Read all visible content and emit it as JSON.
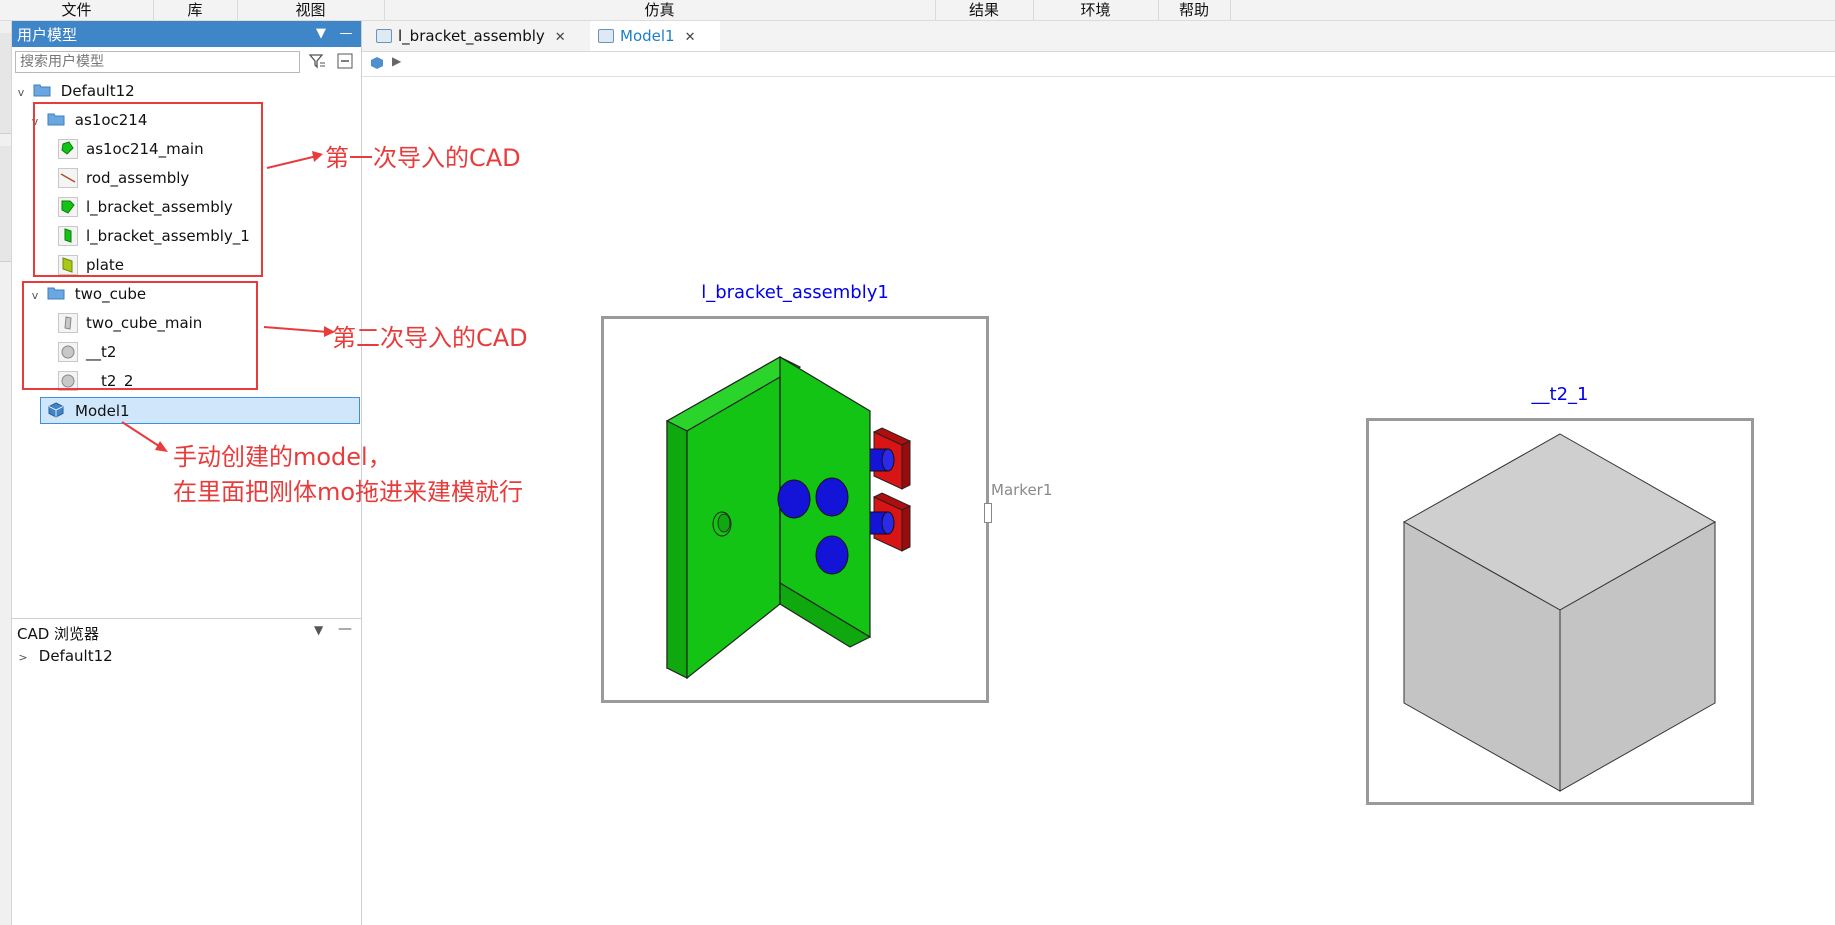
{
  "menu": [
    "文件",
    "库",
    "视图",
    "仿真",
    "结果",
    "环境",
    "帮助"
  ],
  "user_model_panel": {
    "title": "用户模型",
    "search_placeholder": "搜索用户模型",
    "tree": [
      {
        "label": "Default12"
      },
      {
        "label": "as1oc214"
      },
      {
        "label": "as1oc214_main"
      },
      {
        "label": "rod_assembly"
      },
      {
        "label": "l_bracket_assembly"
      },
      {
        "label": "l_bracket_assembly_1"
      },
      {
        "label": "plate"
      },
      {
        "label": "two_cube"
      },
      {
        "label": "two_cube_main"
      },
      {
        "label": "__t2"
      },
      {
        "label": "__t2_2"
      },
      {
        "label": "Model1"
      }
    ]
  },
  "cad_browser": {
    "title": "CAD 浏览器",
    "tree": [
      {
        "label": "Default12"
      }
    ]
  },
  "tabs": [
    {
      "label": "l_bracket_assembly",
      "active": false
    },
    {
      "label": "Model1",
      "active": true
    }
  ],
  "canvas": {
    "part1_title": "l_bracket_assembly1",
    "part2_title": "__t2_1",
    "marker_label": "Marker1"
  },
  "annotations": {
    "first_import": "第一次导入的CAD",
    "second_import": "第二次导入的CAD",
    "manual_line1": "手动创建的model，",
    "manual_line2": "在里面把刚体mo拖进来建模就行"
  },
  "colors": {
    "accent": "#3f86c9",
    "annotation_red": "#e83c3c",
    "part_green": "#14c414",
    "part_blue": "#1414d8",
    "part_red": "#d81414",
    "cube_gray": "#c4c4c4",
    "title_blue": "#0000ee"
  }
}
